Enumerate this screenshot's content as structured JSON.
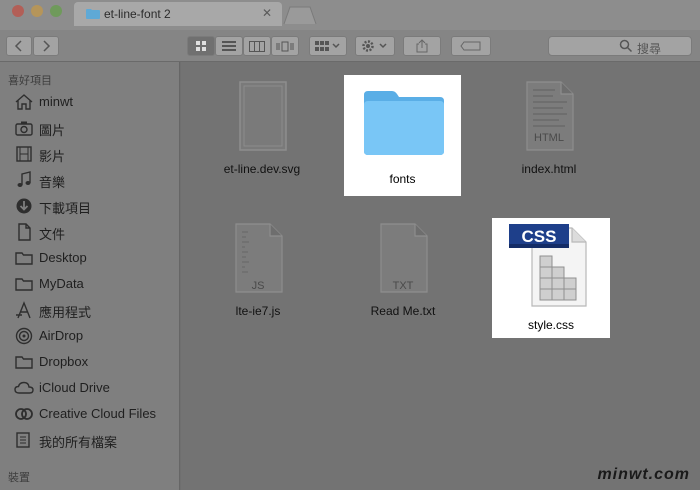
{
  "tab": {
    "title": "et-line-font 2",
    "close_glyph": "✕"
  },
  "search": {
    "placeholder": "搜尋"
  },
  "sidebar": {
    "favorites_header": "喜好項目",
    "devices_header": "裝置",
    "items": [
      {
        "label": "minwt",
        "icon": "home-icon"
      },
      {
        "label": "圖片",
        "icon": "camera-icon"
      },
      {
        "label": "影片",
        "icon": "film-icon"
      },
      {
        "label": "音樂",
        "icon": "music-icon"
      },
      {
        "label": "下載項目",
        "icon": "download-icon"
      },
      {
        "label": "文件",
        "icon": "document-icon"
      },
      {
        "label": "Desktop",
        "icon": "folder-icon"
      },
      {
        "label": "MyData",
        "icon": "folder-icon"
      },
      {
        "label": "應用程式",
        "icon": "apps-icon"
      },
      {
        "label": "AirDrop",
        "icon": "airdrop-icon"
      },
      {
        "label": "Dropbox",
        "icon": "folder-icon"
      },
      {
        "label": "iCloud Drive",
        "icon": "cloud-icon"
      },
      {
        "label": "Creative Cloud Files",
        "icon": "creative-cloud-icon"
      },
      {
        "label": "我的所有檔案",
        "icon": "all-files-icon"
      }
    ]
  },
  "files": [
    {
      "name": "et-line.dev.svg",
      "icon": "svg-file-icon",
      "highlighted": false
    },
    {
      "name": "fonts",
      "icon": "folder-icon",
      "highlighted": true
    },
    {
      "name": "index.html",
      "icon": "html-file-icon",
      "highlighted": false,
      "badge": "HTML"
    },
    {
      "name": "lte-ie7.js",
      "icon": "js-file-icon",
      "highlighted": false,
      "badge": "JS"
    },
    {
      "name": "Read Me.txt",
      "icon": "txt-file-icon",
      "highlighted": false,
      "badge": "TXT"
    },
    {
      "name": "style.css",
      "icon": "css-file-icon",
      "highlighted": true,
      "badge": "CSS"
    }
  ],
  "watermark": "minwt.com",
  "colors": {
    "folder_blue": "#6ec3f4",
    "css_badge": "#1e3f8a"
  }
}
